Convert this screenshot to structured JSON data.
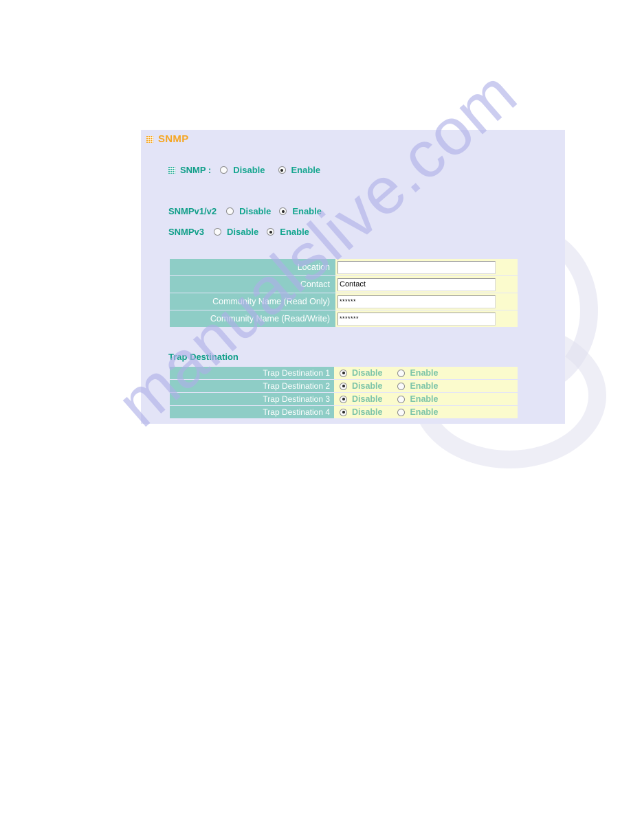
{
  "panel": {
    "title": "SNMP",
    "title_icon": "grid-icon"
  },
  "snmp_master": {
    "label": "SNMP :",
    "icon": "grid-icon",
    "options": [
      "Disable",
      "Enable"
    ],
    "selected": "Enable"
  },
  "versions": [
    {
      "label": "SNMPv1/v2",
      "options": [
        "Disable",
        "Enable"
      ],
      "selected": "Enable"
    },
    {
      "label": "SNMPv3",
      "options": [
        "Disable",
        "Enable"
      ],
      "selected": "Enable"
    }
  ],
  "settings": {
    "rows": [
      {
        "label": "Location",
        "value": "",
        "type": "text"
      },
      {
        "label": "Contact",
        "value": "Contact",
        "type": "text"
      },
      {
        "label": "Community Name (Read Only)",
        "value": "******",
        "type": "password"
      },
      {
        "label": "Community Name (Read/Write)",
        "value": "*******",
        "type": "password"
      }
    ]
  },
  "trap": {
    "heading": "Trap Destination",
    "option_disable": "Disable",
    "option_enable": "Enable",
    "rows": [
      {
        "label": "Trap Destination 1",
        "selected": "Disable"
      },
      {
        "label": "Trap Destination 2",
        "selected": "Disable"
      },
      {
        "label": "Trap Destination 3",
        "selected": "Disable"
      },
      {
        "label": "Trap Destination 4",
        "selected": "Disable"
      }
    ]
  },
  "watermark": {
    "text": "manualslive.com"
  },
  "colors": {
    "panel_bg": "#e3e4f7",
    "label_teal": "#8ecdc6",
    "field_yellow": "#fbfbcd",
    "accent_orange": "#f5a623",
    "heading_green": "#0f9e88"
  }
}
